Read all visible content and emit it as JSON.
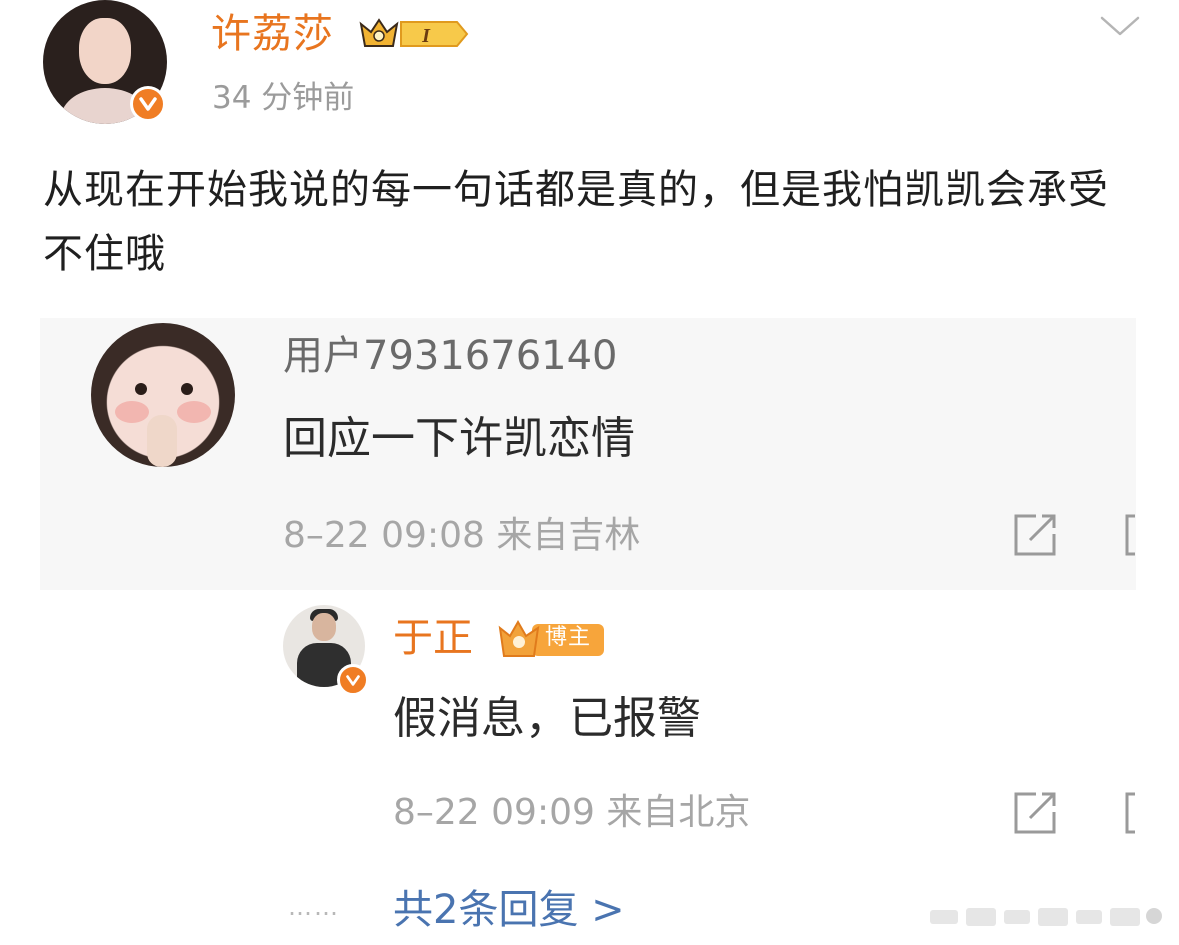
{
  "post": {
    "author": {
      "name": "许荔莎",
      "level": "I",
      "verified": true
    },
    "time": "34 分钟前",
    "text": "从现在开始我说的每一句话都是真的，但是我怕凯凯会承受不住哦"
  },
  "screenshot": {
    "comment": {
      "user": "用户7931676140",
      "text": "回应一下许凯恋情",
      "meta": "8–22 09:08 来自吉林"
    },
    "reply": {
      "user": "于正",
      "badge": "博主",
      "text": "假消息，已报警",
      "meta": "8–22 09:09 来自北京"
    },
    "more_replies": "共2条回复 >",
    "dots": "……"
  },
  "colors": {
    "accent": "#e8751f",
    "verified": "#f07d24",
    "link": "#4a74b0",
    "muted": "#9b9b9b"
  },
  "icons": [
    "chevron-down-icon",
    "verified-icon",
    "crown-icon",
    "share-icon"
  ]
}
